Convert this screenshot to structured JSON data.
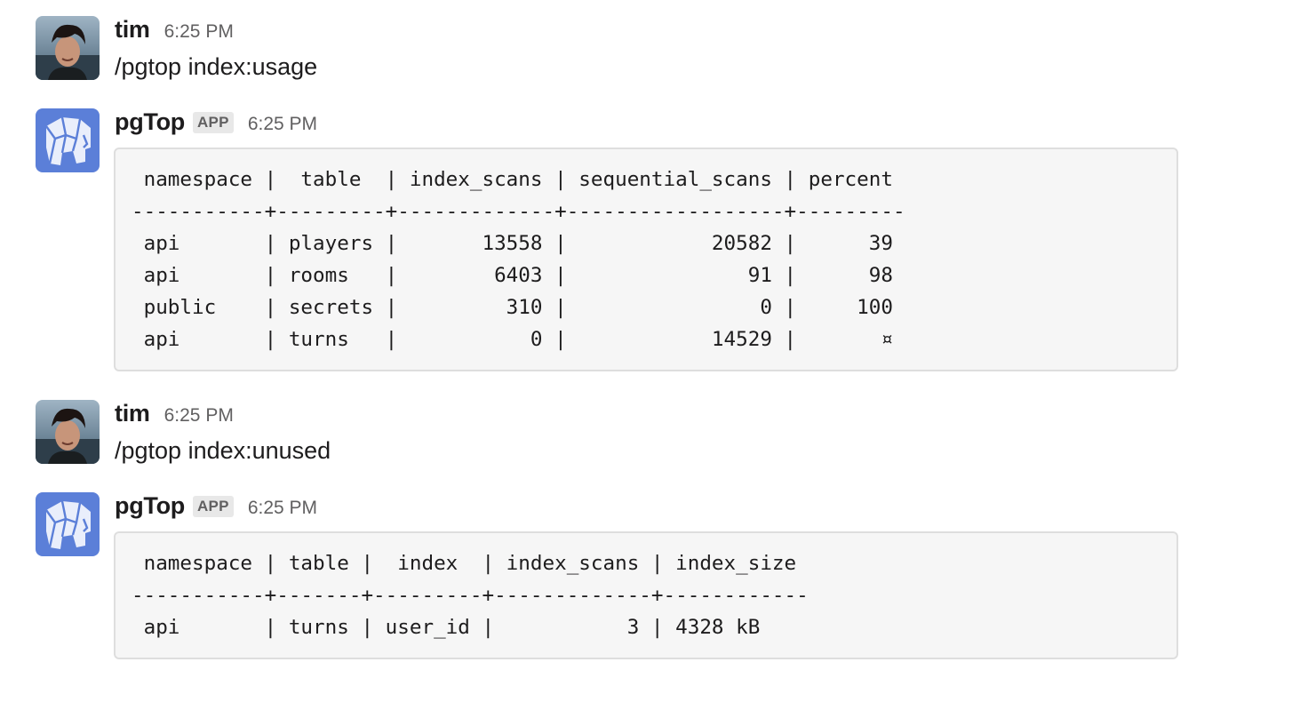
{
  "messages": [
    {
      "sender": "tim",
      "timestamp": "6:25 PM",
      "text": "/pgtop index:usage",
      "avatar_icon": "user-photo-avatar"
    },
    {
      "sender": "pgTop",
      "badge": "APP",
      "timestamp": "6:25 PM",
      "avatar_icon": "elephant-logo-icon",
      "code": " namespace |  table  | index_scans | sequential_scans | percent\n-----------+---------+-------------+------------------+---------\n api       | players |       13558 |            20582 |      39\n api       | rooms   |        6403 |               91 |      98\n public    | secrets |         310 |                0 |     100\n api       | turns   |           0 |            14529 |       ¤"
    },
    {
      "sender": "tim",
      "timestamp": "6:25 PM",
      "text": "/pgtop index:unused",
      "avatar_icon": "user-photo-avatar"
    },
    {
      "sender": "pgTop",
      "badge": "APP",
      "timestamp": "6:25 PM",
      "avatar_icon": "elephant-logo-icon",
      "code": " namespace | table |  index  | index_scans | index_size\n-----------+-------+---------+-------------+------------\n api       | turns | user_id |           3 | 4328 kB"
    }
  ],
  "colors": {
    "app_avatar_bg": "#5b7fd8",
    "code_bg": "#f6f6f6",
    "code_border": "#dedede",
    "timestamp": "#616061"
  }
}
